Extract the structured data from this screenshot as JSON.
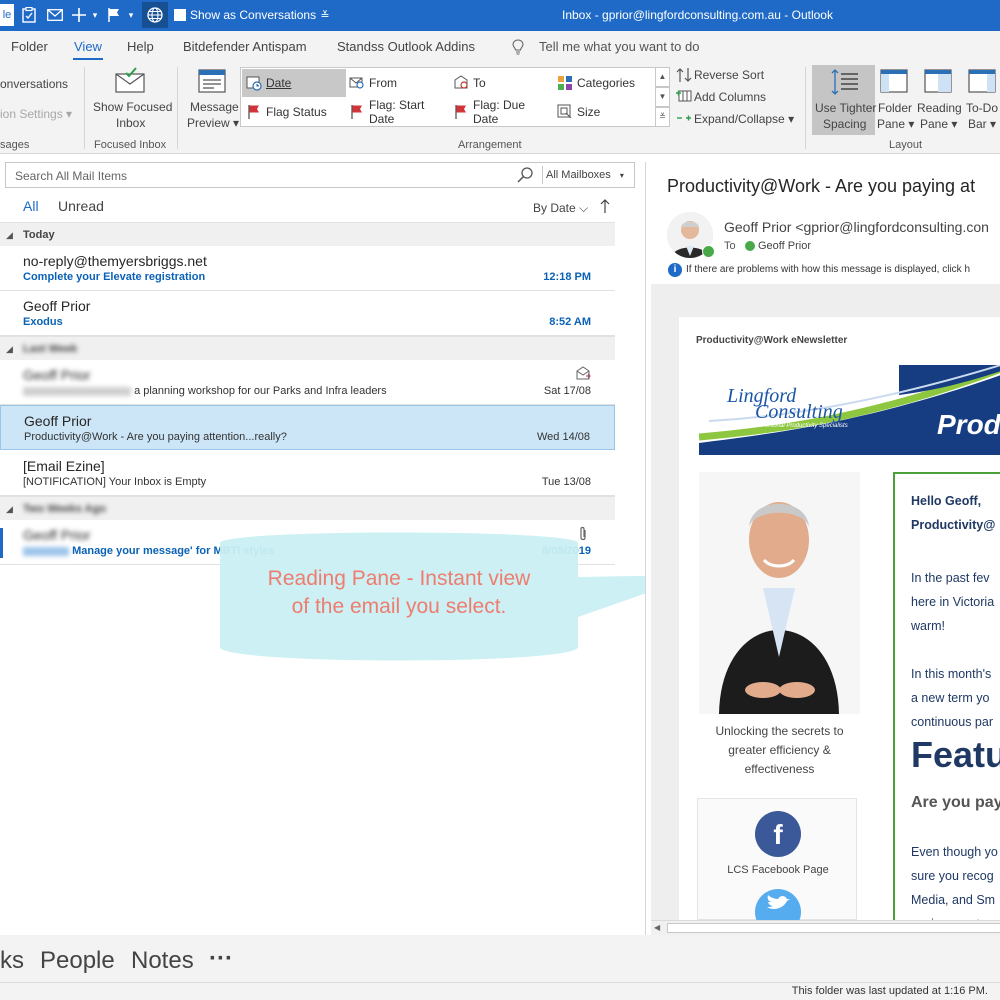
{
  "titlebar": {
    "partial_left": "le",
    "show_conversations": "Show as Conversations",
    "window_title": "Inbox - gprior@lingfordconsulting.com.au  -  Outlook"
  },
  "menu": {
    "tabs": [
      "Folder",
      "View",
      "Help",
      "Bitdefender Antispam",
      "Standss Outlook Addins"
    ],
    "active": "View",
    "tell_me": "Tell me what you want to do"
  },
  "ribbon": {
    "left_partial": {
      "conversations": "onversations",
      "conv_settings": "ion Settings",
      "group_label": "sages"
    },
    "focused": {
      "label_line1": "Show Focused",
      "label_line2": "Inbox",
      "group_label": "Focused Inbox"
    },
    "arrangement": {
      "preview_line1": "Message",
      "preview_line2": "Preview",
      "items": [
        "Date",
        "From",
        "To",
        "Categories",
        "Flag Status",
        "Flag: Start Date",
        "Flag: Due Date",
        "Size"
      ],
      "reverse_sort": "Reverse Sort",
      "add_columns": "Add Columns",
      "expand_collapse": "Expand/Collapse",
      "group_label": "Arrangement"
    },
    "layout": {
      "tighter_line1": "Use Tighter",
      "tighter_line2": "Spacing",
      "folder_line1": "Folder",
      "folder_line2": "Pane",
      "reading_line1": "Reading",
      "reading_line2": "Pane",
      "todo_line1": "To-Do",
      "todo_line2": "Bar",
      "group_label": "Layout"
    }
  },
  "search": {
    "placeholder": "Search All Mail Items",
    "scope": "All Mailboxes"
  },
  "filters": {
    "all": "All",
    "unread": "Unread",
    "sort": "By Date"
  },
  "groups": {
    "today": "Today",
    "last_week": "Last Week",
    "two_weeks": "Two Weeks Ago"
  },
  "messages": [
    {
      "from": "no-reply@themyersbriggs.net",
      "subject": "Complete your Elevate registration",
      "date": "12:18 PM",
      "unread": true
    },
    {
      "from": "Geoff Prior",
      "subject": "Exodus",
      "date": "8:52 AM",
      "unread": true
    },
    {
      "from": "Geoff Prior",
      "subject": "a planning workshop for our Parks and Infra leaders",
      "date": "Sat 17/08",
      "unread": false
    },
    {
      "from": "Geoff Prior",
      "subject": "Productivity@Work - Are you paying attention...really?",
      "date": "Wed 14/08",
      "unread": false
    },
    {
      "from": "[Email Ezine]",
      "subject": "[NOTIFICATION] Your Inbox is Empty",
      "date": "Tue 13/08",
      "unread": false
    },
    {
      "from": "Geoff Prior",
      "subject": "Manage your message' for MBTI styles",
      "date": "8/08/2019",
      "unread": true
    }
  ],
  "callout": {
    "line1": "Reading Pane - Instant view",
    "line2": "of the email you select."
  },
  "reading": {
    "subject": "Productivity@Work - Are you paying at",
    "from": "Geoff Prior <gprior@lingfordconsulting.con",
    "to_label": "To",
    "to": "Geoff Prior",
    "info": "If there are problems with how this message is displayed, click h",
    "newsletter": {
      "header": "Productivity@Work eNewsletter",
      "logo_line1": "Lingford",
      "logo_line2": "Consulting",
      "logo_tagline": "Personal Productivity Specialists",
      "banner_word": "Prod",
      "photo_caption_1": "Unlocking the secrets to",
      "photo_caption_2": "greater efficiency &",
      "photo_caption_3": "effectiveness",
      "facebook_label": "LCS Facebook Page",
      "greeting_1": "Hello  Geoff,",
      "greeting_2": "Productivity@",
      "para1_1": "In the past fev",
      "para1_2": "here in Victoria",
      "para1_3": "warm!",
      "para2_1": "In this month's",
      "para2_2": "a new term yo",
      "para2_3": "continuous par",
      "feature": "Featu",
      "question": "Are you pay",
      "para3_1": "Even though yo",
      "para3_2": "sure you recog",
      "para3_3": "Media, and Sm",
      "para3_4": "environment w"
    }
  },
  "bottom_nav": {
    "items": [
      "ks",
      "People",
      "Notes",
      "···"
    ]
  },
  "status": "This folder was last updated at 1:16 PM.",
  "colors": {
    "accent": "#1e6ac6",
    "unread_blue": "#0a62b6",
    "callout_fill": "#c9eff2",
    "callout_text": "#ee7d6f",
    "newsletter_navy": "#1f3864"
  }
}
